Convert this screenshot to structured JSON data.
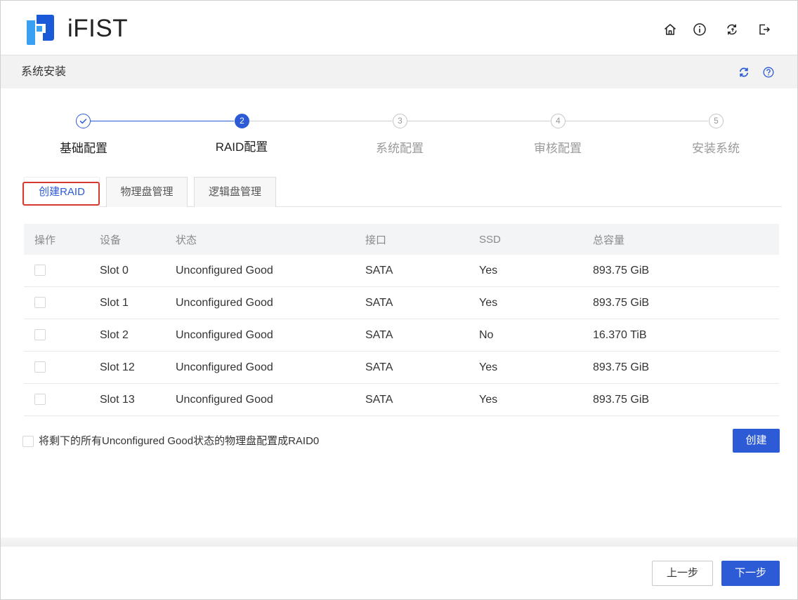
{
  "app": {
    "brand": "iFIST"
  },
  "header_icons": [
    "home-icon",
    "info-icon",
    "switch-icon",
    "logout-icon"
  ],
  "page": {
    "title": "系统安装",
    "icons": [
      "refresh-icon",
      "help-icon"
    ]
  },
  "stepper": {
    "steps": [
      {
        "label": "基础配置",
        "state": "completed",
        "icon": "check-icon"
      },
      {
        "number": "2",
        "label": "RAID配置",
        "state": "active"
      },
      {
        "number": "3",
        "label": "系统配置",
        "state": "pending"
      },
      {
        "number": "4",
        "label": "审核配置",
        "state": "pending"
      },
      {
        "number": "5",
        "label": "安装系统",
        "state": "pending"
      }
    ]
  },
  "tabs": [
    {
      "label": "创建RAID",
      "active": true,
      "highlighted": true
    },
    {
      "label": "物理盘管理",
      "active": false
    },
    {
      "label": "逻辑盘管理",
      "active": false
    }
  ],
  "table": {
    "columns": [
      "操作",
      "设备",
      "状态",
      "接口",
      "SSD",
      "总容量"
    ],
    "rows": [
      {
        "checked": false,
        "device": "Slot 0",
        "state": "Unconfigured Good",
        "interface": "SATA",
        "ssd": "Yes",
        "capacity": "893.75 GiB"
      },
      {
        "checked": false,
        "device": "Slot 1",
        "state": "Unconfigured Good",
        "interface": "SATA",
        "ssd": "Yes",
        "capacity": "893.75 GiB"
      },
      {
        "checked": false,
        "device": "Slot 2",
        "state": "Unconfigured Good",
        "interface": "SATA",
        "ssd": "No",
        "capacity": "16.370 TiB"
      },
      {
        "checked": false,
        "device": "Slot 12",
        "state": "Unconfigured Good",
        "interface": "SATA",
        "ssd": "Yes",
        "capacity": "893.75 GiB"
      },
      {
        "checked": false,
        "device": "Slot 13",
        "state": "Unconfigured Good",
        "interface": "SATA",
        "ssd": "Yes",
        "capacity": "893.75 GiB"
      }
    ]
  },
  "options": {
    "raid0_all_label": "将剩下的所有Unconfigured Good状态的物理盘配置成RAID0",
    "raid0_all_checked": false
  },
  "actions": {
    "create": "创建",
    "prev": "上一步",
    "next": "下一步"
  },
  "colors": {
    "primary": "#2d5bd5",
    "highlight": "#d63a2f",
    "pending": "#9a9a9a",
    "subbar": "#f2f2f2"
  }
}
